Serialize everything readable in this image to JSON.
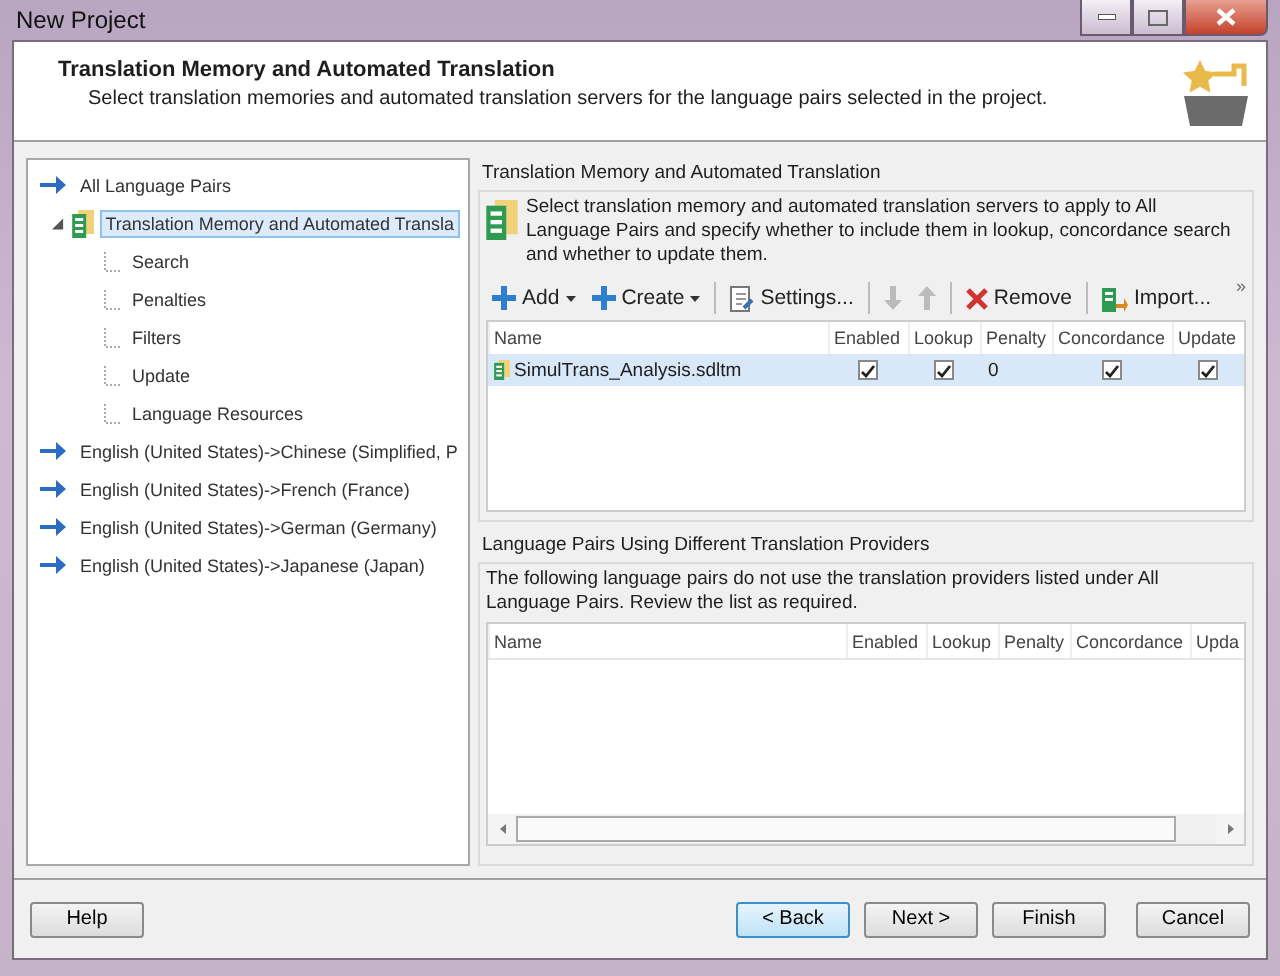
{
  "window": {
    "title": "New Project"
  },
  "header": {
    "title": "Translation Memory and Automated Translation",
    "description": "Select translation memories and automated translation servers for the language pairs selected in the project."
  },
  "tree": [
    {
      "label": "All Language Pairs",
      "kind": "pair",
      "selected": false,
      "children": [
        {
          "label": "Translation Memory and Automated Transla",
          "kind": "provider",
          "selected": true,
          "expanded": true,
          "children": [
            {
              "label": "Search",
              "kind": "setting",
              "selected": false
            },
            {
              "label": "Penalties",
              "kind": "setting",
              "selected": false
            },
            {
              "label": "Filters",
              "kind": "setting",
              "selected": false
            },
            {
              "label": "Update",
              "kind": "setting",
              "selected": false
            },
            {
              "label": "Language Resources",
              "kind": "setting",
              "selected": false
            }
          ]
        }
      ]
    },
    {
      "label": "English (United States)->Chinese (Simplified, P",
      "kind": "pair",
      "selected": false
    },
    {
      "label": "English (United States)->French (France)",
      "kind": "pair",
      "selected": false
    },
    {
      "label": "English (United States)->German (Germany)",
      "kind": "pair",
      "selected": false
    },
    {
      "label": "English (United States)->Japanese (Japan)",
      "kind": "pair",
      "selected": false
    }
  ],
  "tm_section": {
    "title": "Translation Memory and Automated Translation",
    "description": "Select translation memory and automated translation servers to apply to All Language Pairs and specify whether to include them in lookup, concordance search and whether to update them.",
    "toolbar": [
      {
        "kind": "add",
        "label": "Add",
        "disabled": false
      },
      {
        "kind": "create",
        "label": "Create",
        "disabled": false
      },
      {
        "kind": "separator"
      },
      {
        "kind": "settings",
        "label": "Settings...",
        "disabled": false
      },
      {
        "kind": "separator"
      },
      {
        "kind": "move-down",
        "disabled": true
      },
      {
        "kind": "move-up",
        "disabled": true
      },
      {
        "kind": "separator"
      },
      {
        "kind": "remove",
        "label": "Remove",
        "disabled": false
      },
      {
        "kind": "separator"
      },
      {
        "kind": "import",
        "label": "Import...",
        "disabled": false
      }
    ],
    "overflow": "»",
    "columns": [
      "Name",
      "Enabled",
      "Lookup",
      "Penalty",
      "Concordance",
      "Update"
    ],
    "rows": [
      {
        "name": "SimulTrans_Analysis.sdltm",
        "enabled": true,
        "lookup": true,
        "penalty": "0",
        "concordance": true,
        "update": true,
        "selected": true
      }
    ]
  },
  "pairs_section": {
    "title": "Language Pairs Using Different Translation Providers",
    "description": "The following language pairs do not use the translation providers listed under All Language Pairs. Review the list as required.",
    "columns": [
      "Name",
      "Enabled",
      "Lookup",
      "Penalty",
      "Concordance",
      "Upda"
    ]
  },
  "buttons": [
    {
      "label": "Help",
      "focused": false
    },
    {
      "label": "< Back",
      "focused": true
    },
    {
      "label": "Next >",
      "focused": false
    },
    {
      "label": "Finish",
      "focused": false
    },
    {
      "label": "Cancel",
      "focused": false
    }
  ]
}
